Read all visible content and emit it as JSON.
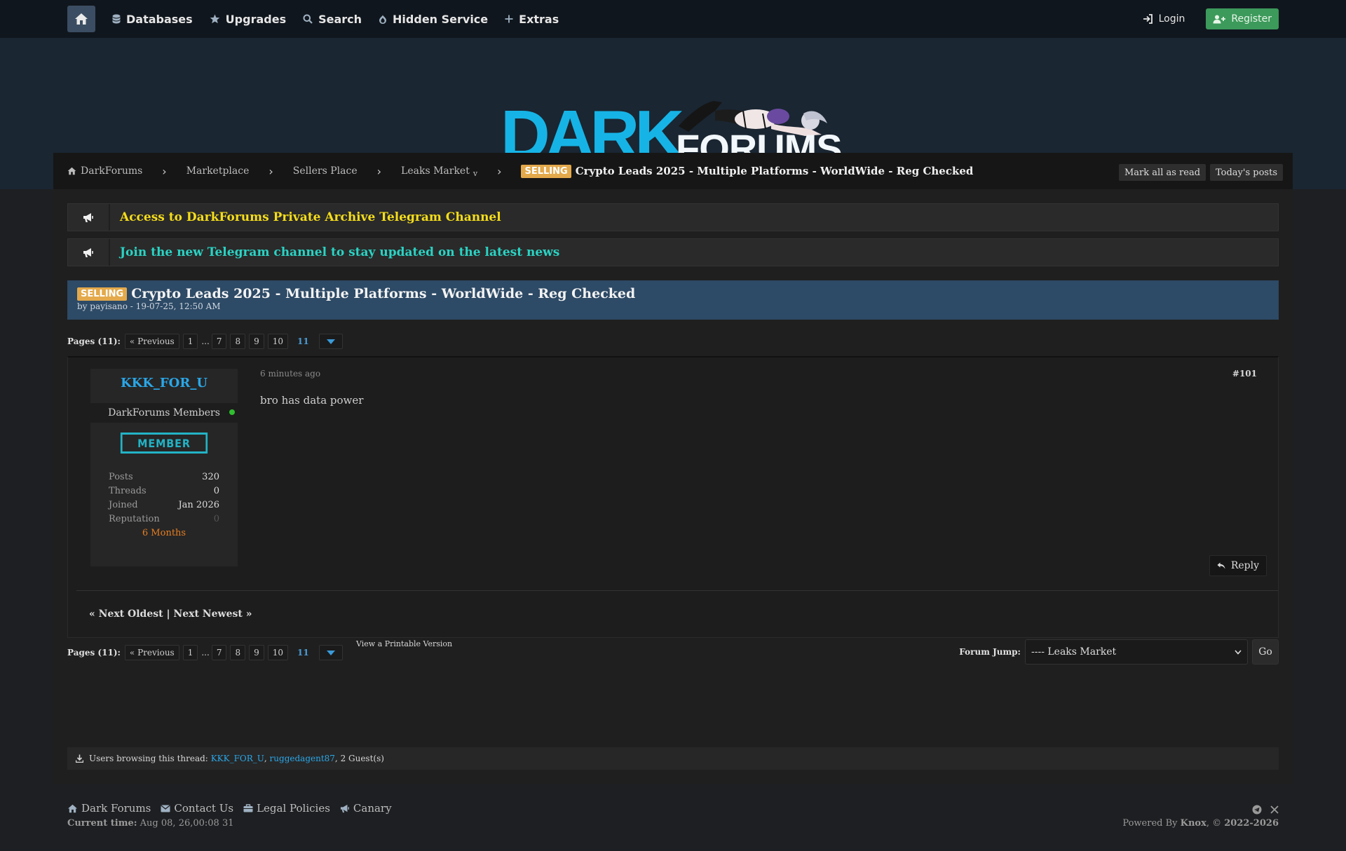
{
  "nav": {
    "items": [
      "Databases",
      "Upgrades",
      "Search",
      "Hidden Service",
      "Extras"
    ],
    "login": "Login",
    "register": "Register"
  },
  "logo": {
    "dark": "DARK",
    "forums": "FORUMS"
  },
  "breadcrumb": {
    "items": [
      "DarkForums",
      "Marketplace",
      "Sellers Place",
      "Leaks Market"
    ],
    "dropdown_mark": "v",
    "badge": "SELLING",
    "title": "Crypto Leads 2025 - Multiple Platforms - WorldWide - Reg Checked",
    "mark_all_read": "Mark all as read",
    "todays_posts": "Today's posts"
  },
  "announcements": [
    {
      "text": "Access to DarkForums Private Archive Telegram Channel",
      "color": "#f5dd1a"
    },
    {
      "text": "Join the new Telegram channel to stay updated on the latest news",
      "color": "#2ad3c4"
    }
  ],
  "thread": {
    "badge": "SELLING",
    "title": "Crypto Leads 2025 - Multiple Platforms - WorldWide - Reg Checked",
    "byline": "by payisano - 19-07-25, 12:50 AM"
  },
  "pagination": {
    "label": "Pages (11):",
    "previous": "« Previous",
    "pages": [
      "1",
      "7",
      "8",
      "9",
      "10"
    ],
    "dots": "...",
    "current": "11"
  },
  "post": {
    "author": "KKK_FOR_U",
    "group": "DarkForums Members",
    "rank": "MEMBER",
    "stats": [
      {
        "label": "Posts",
        "value": "320"
      },
      {
        "label": "Threads",
        "value": "0"
      },
      {
        "label": "Joined",
        "value": "Jan 2026"
      },
      {
        "label": "Reputation",
        "value": "0"
      }
    ],
    "age": "6 Months",
    "time": "6 minutes ago",
    "number": "#101",
    "body": "bro has data power",
    "reply": "Reply"
  },
  "thread_nav": {
    "text": "« Next Oldest | Next Newest »"
  },
  "printable": "View a Printable Version",
  "forum_jump": {
    "label": "Forum Jump:",
    "selected": "---- Leaks Market",
    "go": "Go"
  },
  "browsing": {
    "prefix": "Users browsing this thread:",
    "users": [
      "KKK_FOR_U",
      "ruggedagent87"
    ],
    "guests": "2 Guest(s)"
  },
  "footer": {
    "links": [
      "Dark Forums",
      "Contact Us",
      "Legal Policies",
      "Canary"
    ],
    "time_label": "Current time:",
    "time_value": "Aug 08, 26,00:08 31",
    "powered_prefix": "Powered By",
    "powered_name": "Knox",
    "copyright_sep": ", ©",
    "copyright_years": "2022-2026"
  }
}
